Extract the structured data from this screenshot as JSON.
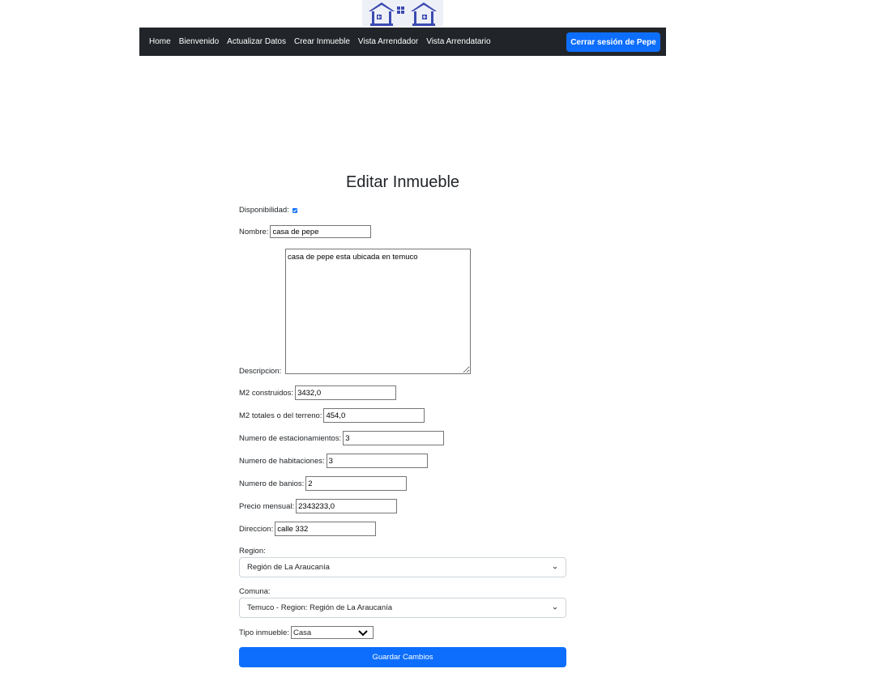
{
  "nav": {
    "links": [
      "Home",
      "Bienvenido",
      "Actualizar Datos",
      "Crear Inmueble",
      "Vista Arrendador",
      "Vista Arrendatario"
    ],
    "logout_label": "Cerrar sesión de Pepe"
  },
  "form": {
    "title": "Editar Inmueble",
    "disponibilidad_label": "Disponibilidad:",
    "disponibilidad_checked": true,
    "nombre_label": "Nombre:",
    "nombre_value": "casa de pepe",
    "descripcion_label": "Descripcion:",
    "descripcion_value": "casa de pepe esta ubicada en temuco",
    "m2_construidos_label": "M2 construidos:",
    "m2_construidos_value": "3432,0",
    "m2_totales_label": "M2 totales o del terreno:",
    "m2_totales_value": "454,0",
    "estacionamientos_label": "Numero de estacionamientos:",
    "estacionamientos_value": "3",
    "habitaciones_label": "Numero de habitaciones:",
    "habitaciones_value": "3",
    "banios_label": "Numero de banios:",
    "banios_value": "2",
    "precio_label": "Precio mensual:",
    "precio_value": "2343233,0",
    "direccion_label": "Direccion:",
    "direccion_value": "calle 332",
    "region_label": "Region:",
    "region_value": "Región de La Araucanía",
    "comuna_label": "Comuna:",
    "comuna_value": "Temuco - Region: Región de La Araucanía",
    "tipo_label": "Tipo inmueble:",
    "tipo_value": "Casa",
    "save_label": "Guardar Cambios"
  },
  "colors": {
    "navbar": "#212529",
    "primary": "#0d6efd",
    "logo": "#3b4bb0"
  }
}
